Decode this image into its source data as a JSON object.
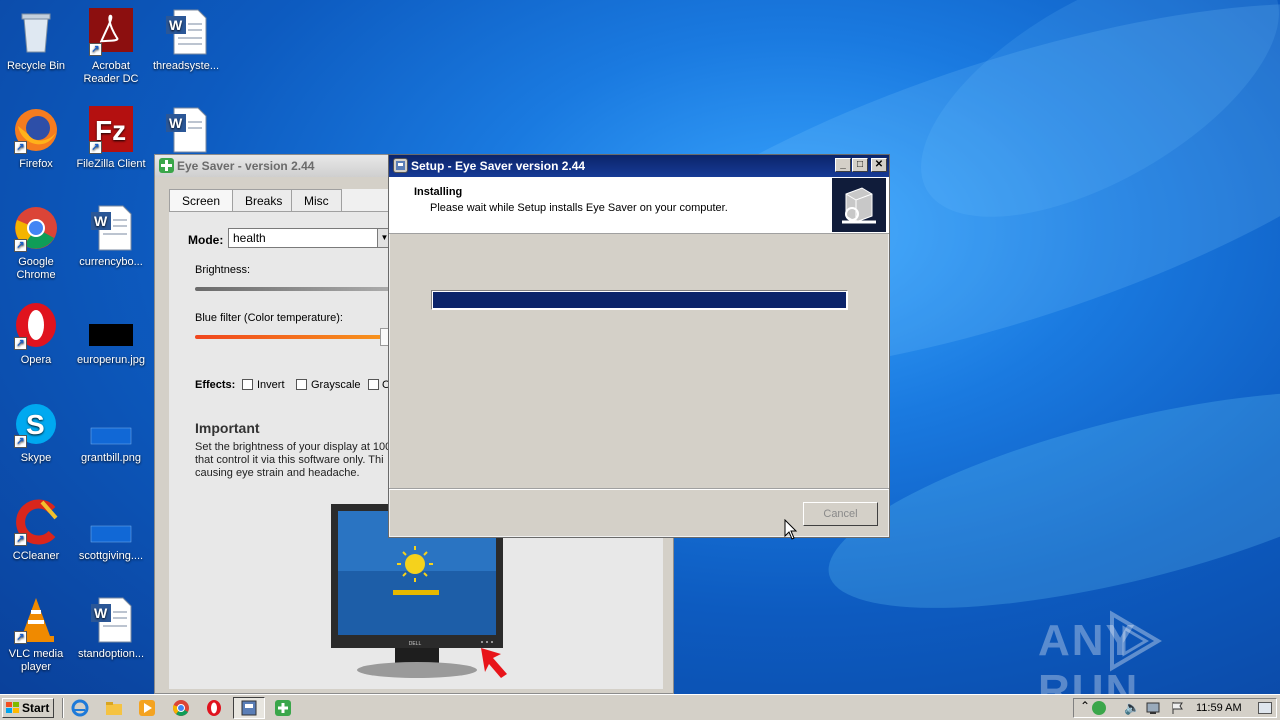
{
  "desktop": {
    "icons": [
      {
        "label": "Recycle Bin"
      },
      {
        "label": "Acrobat Reader DC"
      },
      {
        "label": "threadsyste..."
      },
      {
        "label": "Firefox"
      },
      {
        "label": "FileZilla Client"
      },
      {
        "label": ""
      },
      {
        "label": "Google Chrome"
      },
      {
        "label": "currencybo..."
      },
      {
        "label": "Opera"
      },
      {
        "label": "europerun.jpg"
      },
      {
        "label": "Skype"
      },
      {
        "label": "grantbill.png"
      },
      {
        "label": "CCleaner"
      },
      {
        "label": "scottgiving...."
      },
      {
        "label": "VLC media player"
      },
      {
        "label": "standoption..."
      }
    ],
    "watermark": "ANY RUN"
  },
  "eye_saver": {
    "title": "Eye Saver - version 2.44",
    "tabs": [
      "Screen",
      "Breaks",
      "Misc"
    ],
    "mode_label": "Mode:",
    "mode_value": "health",
    "brightness_label": "Brightness:",
    "blue_filter_label": "Blue filter (Color temperature):",
    "effects_label": "Effects:",
    "effects": [
      "Invert",
      "Grayscale",
      "O"
    ],
    "important_heading": "Important",
    "important_lines": [
      "Set the brightness of your display at 100",
      "that control it via this software only. Thi",
      "causing eye strain and headache."
    ]
  },
  "setup": {
    "title": "Setup - Eye Saver version 2.44",
    "heading": "Installing",
    "subheading": "Please wait while Setup installs Eye Saver on your computer.",
    "progress": 1.0,
    "cancel_label": "Cancel"
  },
  "taskbar": {
    "start_label": "Start",
    "clock": "11:59 AM"
  },
  "colors": {
    "progress_fill": "#0b246a",
    "title_active": "#0b246a"
  }
}
